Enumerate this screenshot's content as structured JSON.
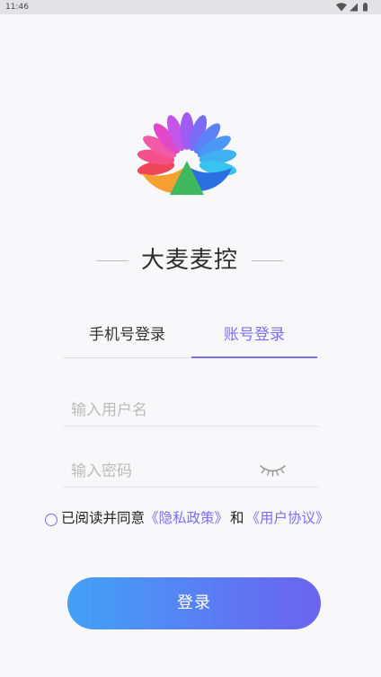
{
  "status_bar": {
    "time": "11:46",
    "icons": [
      "wifi-icon",
      "signal-icon",
      "battery-icon"
    ]
  },
  "app": {
    "title": "大麦麦控",
    "logo_icon": "flower-fan-logo"
  },
  "tabs": [
    {
      "label": "手机号登录",
      "active": false
    },
    {
      "label": "账号登录",
      "active": true
    }
  ],
  "form": {
    "username": {
      "value": "",
      "placeholder": "输入用户名"
    },
    "password": {
      "value": "",
      "placeholder": "输入密码",
      "toggle_icon": "eye-closed-icon"
    }
  },
  "agreement": {
    "checked": false,
    "prefix": "已阅读并同意",
    "privacy_link": "《隐私政策》",
    "conjunction": "和",
    "terms_link": "《用户协议》"
  },
  "login_button": {
    "label": "登录"
  },
  "colors": {
    "background": "#f8f8fa",
    "accent": "#7b6ef5",
    "button_gradient_start": "#42a1f7",
    "button_gradient_end": "#6c62f0",
    "text": "#333333",
    "placeholder": "#bbbbbb"
  }
}
